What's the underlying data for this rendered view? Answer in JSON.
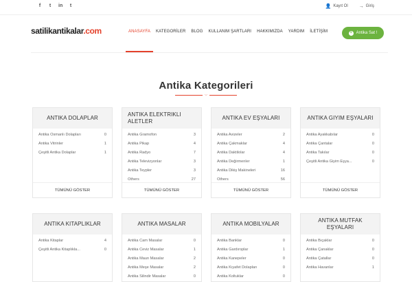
{
  "topbar": {
    "social": [
      "f",
      "t",
      "in",
      "t"
    ],
    "social_icons": [
      "facebook-icon",
      "twitter-icon",
      "linkedin-icon",
      "tumblr-icon"
    ],
    "register_label": "Kayıt Ol",
    "login_label": "Giriş"
  },
  "header": {
    "logo_main": "satilikantikalar",
    "logo_suffix": ".com",
    "nav": [
      "ANASAYFA",
      "KATEGORİLER",
      "BLOG",
      "KULLANIM ŞARTLARI",
      "HAKKIMIZDA",
      "YARDIM",
      "İLETİŞİM"
    ],
    "active_nav": "ANASAYFA",
    "sell_button": "Antika Sat !"
  },
  "section": {
    "title": "Antika Kategorileri"
  },
  "colors": {
    "accent": "#e4412b",
    "button": "#6cb33f"
  },
  "categories": [
    {
      "title": "ANTIKA DOLAPLAR",
      "items": [
        {
          "name": "Antika Osmanlı Dolapları",
          "count": "0"
        },
        {
          "name": "Antika Vitrinler",
          "count": "1"
        },
        {
          "name": "Çeşitli Antika Dolaplar",
          "count": "1"
        }
      ],
      "more": "TÜMÜNÜ GÖSTER"
    },
    {
      "title": "ANTIKA ELEKTRIKLI ALETLER",
      "items": [
        {
          "name": "Antika Gramofon",
          "count": "3"
        },
        {
          "name": "Antika Pikap",
          "count": "4"
        },
        {
          "name": "Antika Radyo",
          "count": "7"
        },
        {
          "name": "Antika Televizyonlar",
          "count": "3"
        },
        {
          "name": "Antika Teypler",
          "count": "3"
        },
        {
          "name": "Others",
          "count": "27"
        }
      ],
      "more": "TÜMÜNÜ GÖSTER"
    },
    {
      "title": "ANTIKA EV EŞYALARI",
      "items": [
        {
          "name": "Antika Avizeler",
          "count": "2"
        },
        {
          "name": "Antika Çakmaklar",
          "count": "4"
        },
        {
          "name": "Antika Daktilolar",
          "count": "4"
        },
        {
          "name": "Antika Değirmenler",
          "count": "1"
        },
        {
          "name": "Antika Dikiş Makineleri",
          "count": "16"
        },
        {
          "name": "Others",
          "count": "56"
        }
      ],
      "more": "TÜMÜNÜ GÖSTER"
    },
    {
      "title": "ANTIKA GIYIM EŞYALARI",
      "items": [
        {
          "name": "Antika Ayakkabılar",
          "count": "0"
        },
        {
          "name": "Antika Çantalar",
          "count": "0"
        },
        {
          "name": "Antika Takılar",
          "count": "0"
        },
        {
          "name": "Çeşitli Antika Giyim Eşya...",
          "count": "0"
        }
      ],
      "more": "TÜMÜNÜ GÖSTER"
    },
    {
      "title": "ANTIKA KITAPLIKLAR",
      "items": [
        {
          "name": "Antika Kitaplar",
          "count": "4"
        },
        {
          "name": "Çeşitli Antika Kitaplıkla...",
          "count": "0"
        }
      ],
      "more": ""
    },
    {
      "title": "ANTIKA MASALAR",
      "items": [
        {
          "name": "Antika Cam Masalar",
          "count": "0"
        },
        {
          "name": "Antika Ceviz Masalar",
          "count": "1"
        },
        {
          "name": "Antika Maun Masalar",
          "count": "2"
        },
        {
          "name": "Antika Meşe Masalar",
          "count": "2"
        },
        {
          "name": "Antika Silindir Masalar",
          "count": "0"
        }
      ],
      "more": ""
    },
    {
      "title": "ANTIKA MOBILYALAR",
      "items": [
        {
          "name": "Antika Banklar",
          "count": "0"
        },
        {
          "name": "Antika Gardıroplar",
          "count": "1"
        },
        {
          "name": "Antika Kanepeler",
          "count": "0"
        },
        {
          "name": "Antika Kıyafet Dolapları",
          "count": "0"
        },
        {
          "name": "Antika Koltuklar",
          "count": "0"
        }
      ],
      "more": ""
    },
    {
      "title": "ANTIKA MUTFAK EŞYALARI",
      "items": [
        {
          "name": "Antika Bıçaklar",
          "count": "0"
        },
        {
          "name": "Antika Çanaklar",
          "count": "0"
        },
        {
          "name": "Antika Çatallar",
          "count": "0"
        },
        {
          "name": "Antika Havanlar",
          "count": "1"
        }
      ],
      "more": ""
    }
  ]
}
